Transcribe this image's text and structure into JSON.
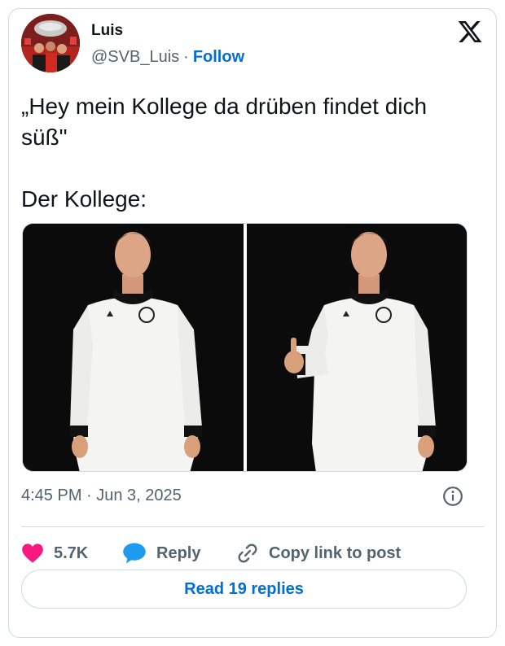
{
  "author": {
    "name": "Luis",
    "handle": "@SVB_Luis",
    "separator": "·",
    "follow_label": "Follow",
    "avatar_icon": "profile-photo",
    "platform_icon": "x-logo"
  },
  "tweet": {
    "line1": "„Hey mein Kollege da drüben findet dich süß\"",
    "line2": "Der Kollege:",
    "timestamp": "4:45 PM · Jun 3, 2025"
  },
  "media": {
    "count": 2,
    "background_color": "#0b0b0b",
    "jersey_color": "#f4f4f2"
  },
  "actions": {
    "likes": "5.7K",
    "reply_label": "Reply",
    "copy_link_label": "Copy link to post",
    "read_replies_label": "Read 19 replies"
  },
  "colors": {
    "accent": "#006fd6",
    "heart": "#f91880",
    "secondary_text": "#536471",
    "border": "#cfd9de"
  }
}
